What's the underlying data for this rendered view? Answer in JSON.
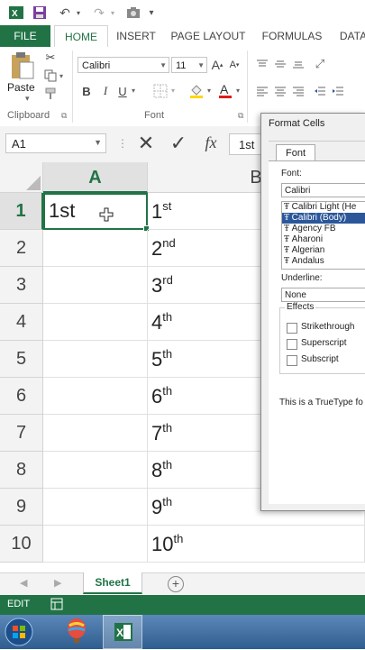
{
  "qat": {
    "icons": [
      "excel-logo-icon",
      "save-icon",
      "undo-icon",
      "redo-icon",
      "camera-icon",
      "customize-icon"
    ]
  },
  "tabs": {
    "file": "FILE",
    "home": "HOME",
    "insert": "INSERT",
    "page_layout": "PAGE LAYOUT",
    "formulas": "FORMULAS",
    "data": "DATA"
  },
  "ribbon": {
    "paste_label": "Paste",
    "clipboard_label": "Clipboard",
    "font_label": "Font",
    "font_name": "Calibri",
    "font_size": "11",
    "bold": "B",
    "italic": "I",
    "underline": "U",
    "grow_font": "A",
    "shrink_font": "A"
  },
  "formula_bar": {
    "name_box": "A1",
    "fx": "fx",
    "content": "1st"
  },
  "grid": {
    "columns": [
      "A",
      "B"
    ],
    "rows": [
      "1",
      "2",
      "3",
      "4",
      "5",
      "6",
      "7",
      "8",
      "9",
      "10"
    ],
    "col_a": [
      "1st",
      "",
      "",
      "",
      "",
      "",
      "",
      "",
      "",
      ""
    ],
    "col_b_base": [
      "1",
      "2",
      "3",
      "4",
      "5",
      "6",
      "7",
      "8",
      "9",
      "10"
    ],
    "col_b_sup": [
      "st",
      "nd",
      "rd",
      "th",
      "th",
      "th",
      "th",
      "th",
      "th",
      "th"
    ]
  },
  "sheets": {
    "active": "Sheet1",
    "add": "+"
  },
  "status": {
    "mode": "EDIT"
  },
  "dialog": {
    "title": "Format Cells",
    "tab": "Font",
    "font_label": "Font:",
    "font_value": "Calibri",
    "font_list": [
      "Calibri Light (He",
      "Calibri (Body)",
      "Agency FB",
      "Aharoni",
      "Algerian",
      "Andalus"
    ],
    "underline_label": "Underline:",
    "underline_value": "None",
    "effects_label": "Effects",
    "strikethrough": "Strikethrough",
    "superscript": "Superscript",
    "subscript": "Subscript",
    "note": "This is a TrueType fo"
  },
  "colors": {
    "accent": "#217346",
    "selection": "#2b579a"
  }
}
